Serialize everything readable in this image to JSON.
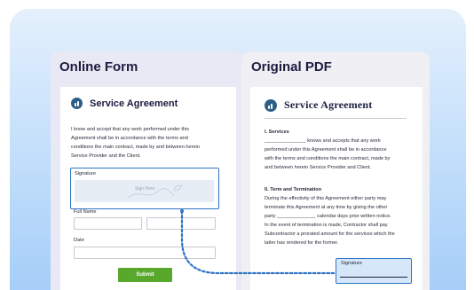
{
  "left_panel": {
    "title": "Online Form",
    "doc_title": "Service Agreement",
    "agreement_lines": [
      "I know and accept that any work performed under this",
      "Agreement shall be in accordance with the terms and",
      "conditions the main contract, made by and between herein",
      "Service Provider and the Client."
    ],
    "signature_label": "Signature",
    "signature_hint": "Sign Here",
    "full_name_label": "Full Name",
    "date_label": "Date",
    "submit_label": "Submit"
  },
  "right_panel": {
    "title": "Original PDF",
    "doc_title": "Service Agreement",
    "section1_heading": "I. Services",
    "section1_lines": [
      "_______________ knows and accepts that any work",
      "performed under this Agreement shall be in accordance",
      "with the terms and conditions the main contract, made by",
      "and between herein Service Provider and Client."
    ],
    "section2_heading": "II. Term and Termination",
    "section2_lines": [
      "During the effectivity of this Agreement either party may",
      "terminate this Agreement at any time by giving the other",
      "party ______________ calendar days prior written notice.",
      "In the event of termination is made, Contractor shall pay",
      "Subcontractor a prorated amount for the services which the",
      "latter has rendered for the former."
    ],
    "signature_label": "Signature"
  },
  "colors": {
    "accent": "#2f73c5",
    "submit": "#58a82b",
    "title": "#1b1d3f"
  }
}
